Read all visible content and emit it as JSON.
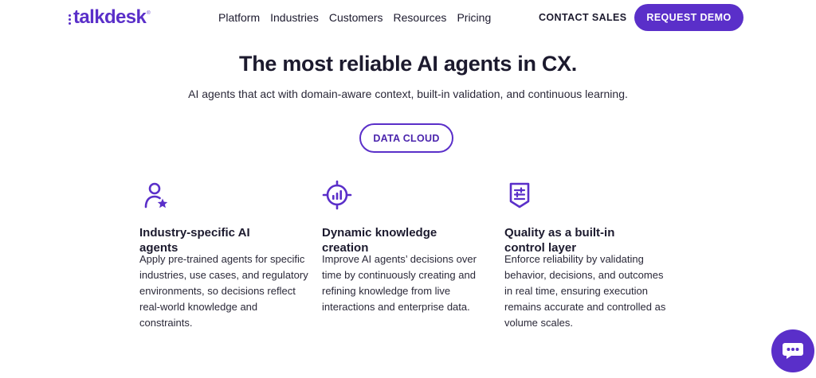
{
  "nav": {
    "logo_text": "talkdesk",
    "logo_mark": "®",
    "menu": [
      "Platform",
      "Industries",
      "Customers",
      "Resources",
      "Pricing"
    ],
    "contact_label": "CONTACT SALES",
    "demo_label": "REQUEST DEMO"
  },
  "hero": {
    "title": "The most reliable AI agents in CX.",
    "subtitle": "AI agents that act with domain-aware context, built-in validation, and continuous learning.",
    "button_label": "DATA CLOUD"
  },
  "features": [
    {
      "icon": "user-star-icon",
      "title": "Industry-specific AI agents",
      "body": "Apply pre-trained agents for specific industries, use cases, and regulatory environments, so decisions reflect real-world knowledge and constraints."
    },
    {
      "icon": "target-chart-icon",
      "title": "Dynamic knowledge creation",
      "body": "Improve AI agents’ decisions over time by continuously creating and refining knowledge from live interactions and enterprise data."
    },
    {
      "icon": "shield-sliders-icon",
      "title": "Quality as a built-in control layer",
      "body": "Enforce reliability by validating behavior, decisions, and outcomes in real time, ensuring execution remains accurate and controlled as volume scales."
    }
  ],
  "chat": {
    "icon": "chat-bubble-icon"
  },
  "colors": {
    "brand": "#5a2fc9",
    "text": "#1c1a2e"
  }
}
